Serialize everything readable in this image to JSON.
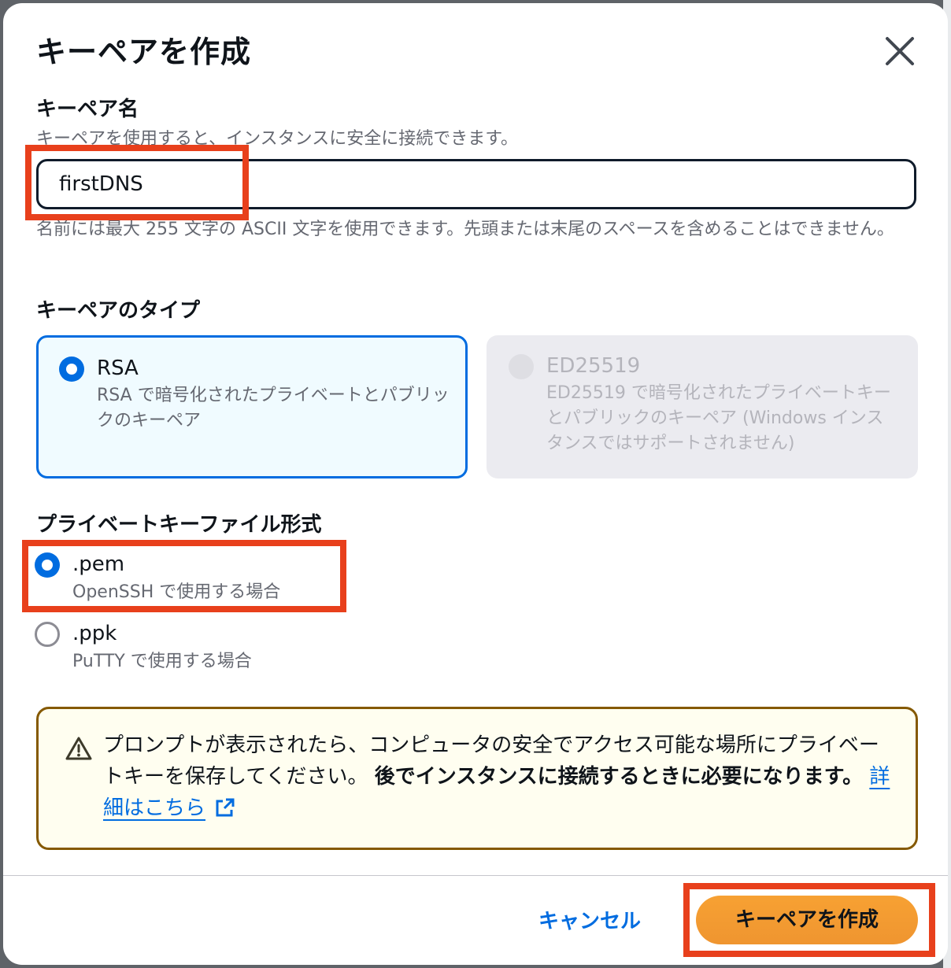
{
  "dialog": {
    "title": "キーペアを作成"
  },
  "key_name": {
    "label": "キーペア名",
    "description": "キーペアを使用すると、インスタンスに安全に接続できます。",
    "value": "firstDNS",
    "hint": "名前には最大 255 文字の ASCII 文字を使用できます。先頭または末尾のスペースを含めることはできません。"
  },
  "key_type": {
    "label": "キーペアのタイプ",
    "options": [
      {
        "title": "RSA",
        "description": "RSA で暗号化されたプライベートとパブリックのキーペア",
        "selected": true,
        "disabled": false
      },
      {
        "title": "ED25519",
        "description": "ED25519 で暗号化されたプライベートキーとパブリックのキーペア (Windows インスタンスではサポートされません)",
        "selected": false,
        "disabled": true
      }
    ]
  },
  "file_format": {
    "label": "プライベートキーファイル形式",
    "options": [
      {
        "title": ".pem",
        "description": "OpenSSH で使用する場合",
        "selected": true
      },
      {
        "title": ".ppk",
        "description": "PuTTY で使用する場合",
        "selected": false
      }
    ]
  },
  "warning": {
    "icon": "warning-icon",
    "text_part1": "プロンプトが表示されたら、コンピュータの安全でアクセス可能な場所にプライベートキーを保存してください。",
    "text_bold": "後でインスタンスに接続するときに必要になります。",
    "link": "詳細はこちら",
    "link_icon": "external-link-icon"
  },
  "footer": {
    "cancel_label": "キャンセル",
    "create_label": "キーペアを作成"
  },
  "colors": {
    "accent": "#006ce0",
    "primary_button": "#f29b31",
    "highlight": "#e8401c",
    "warning_border": "#855900",
    "warning_bg": "#fffef0"
  }
}
